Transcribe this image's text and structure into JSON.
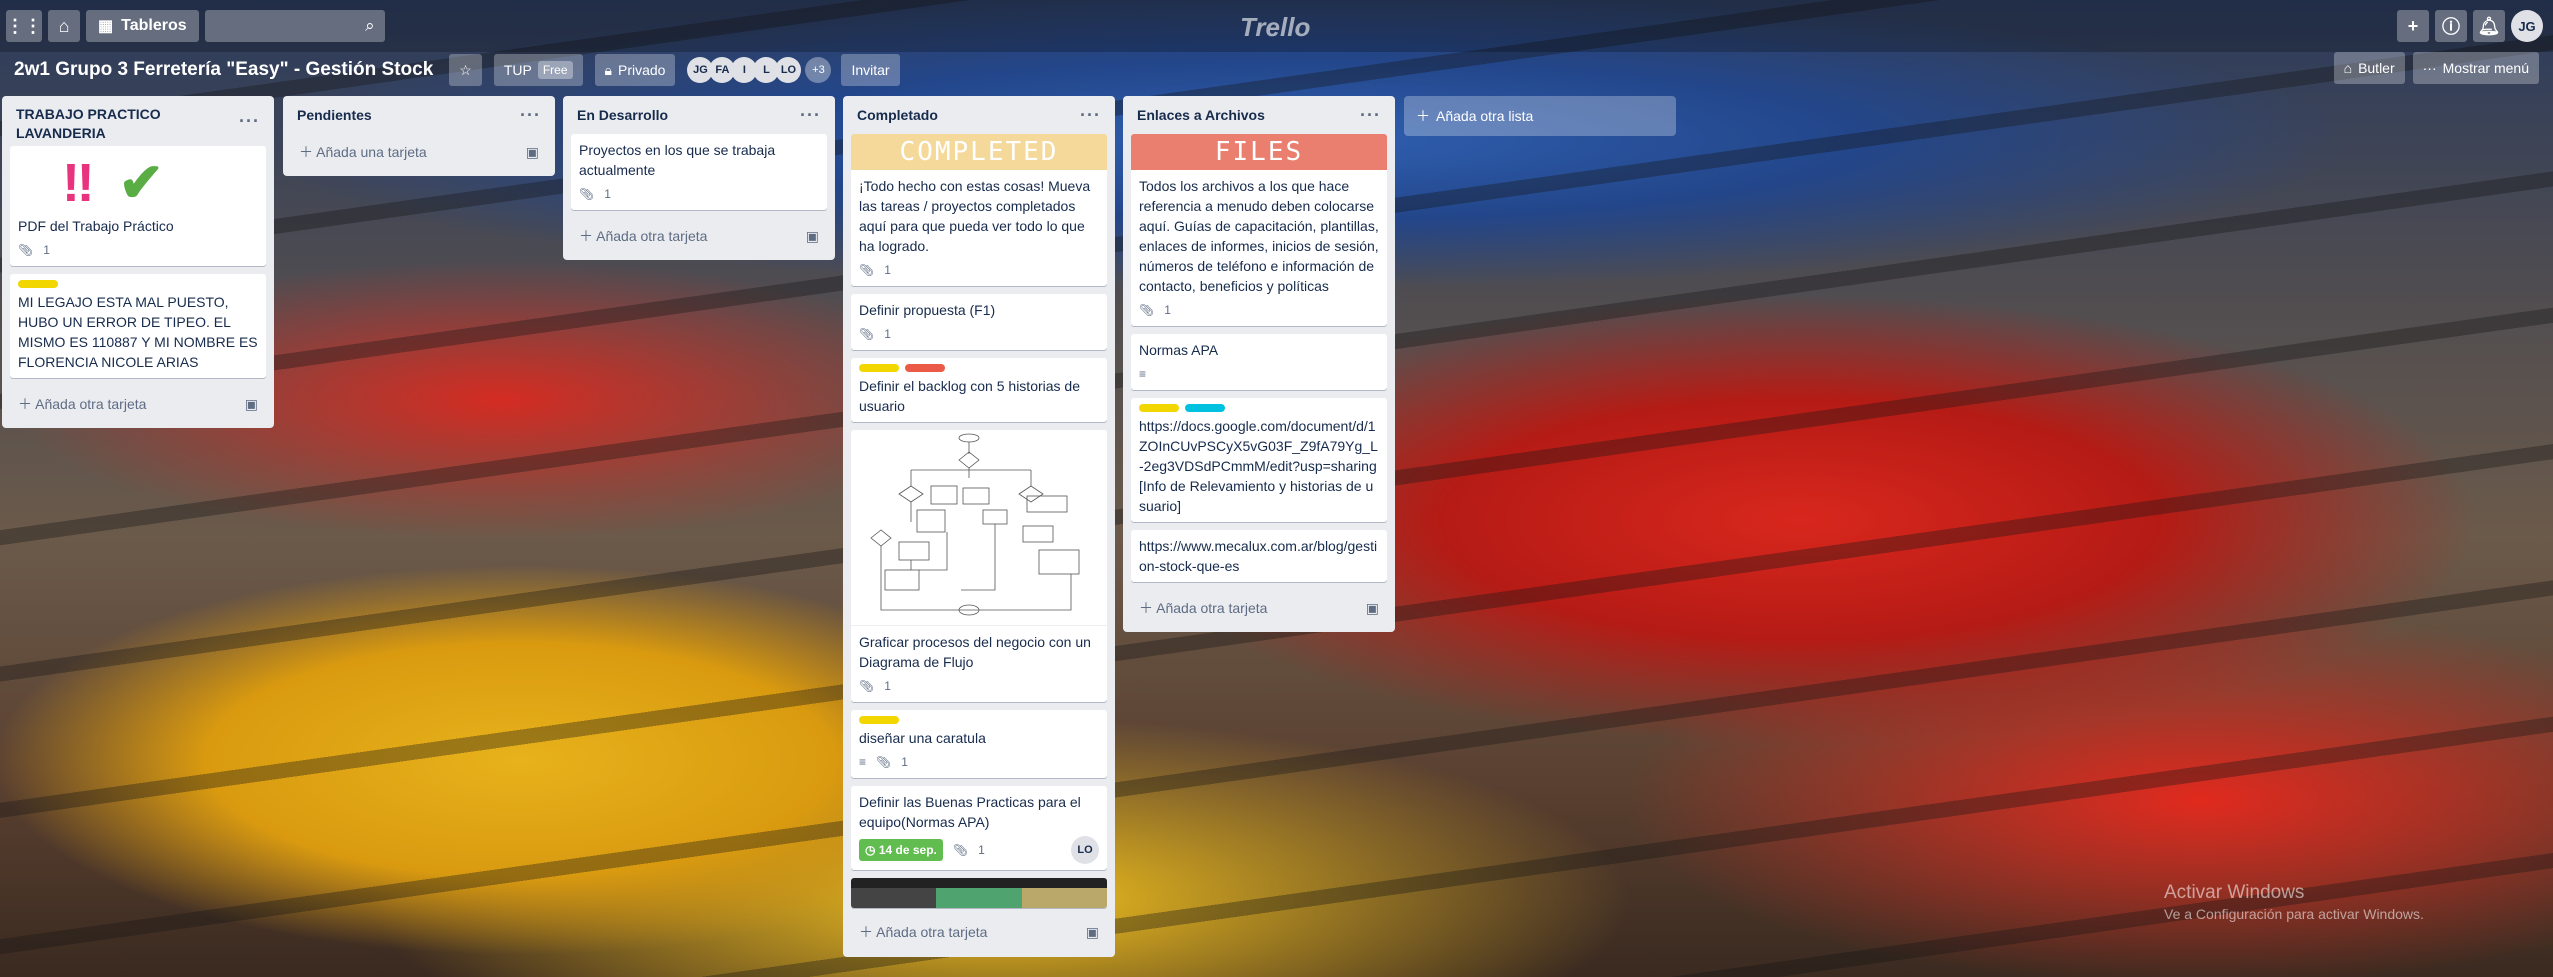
{
  "header": {
    "boards_label": "Tableros",
    "search_placeholder": "",
    "logo": "Trello",
    "user_initials": "JG"
  },
  "board": {
    "title": "2w1 Grupo 3 Ferretería \"Easy\" - Gestión Stock",
    "team": "TUP",
    "team_badge": "Free",
    "visibility": "Privado",
    "members": [
      "JG",
      "FA",
      "I",
      "L",
      "LO"
    ],
    "more_members": "+3",
    "invite": "Invitar",
    "butler": "Butler",
    "show_menu": "Mostrar menú"
  },
  "lists": [
    {
      "title": "TRABAJO PRACTICO LAVANDERIA",
      "cards": [
        {
          "text": "PDF del Trabajo Práctico",
          "attachments": "1"
        },
        {
          "text": "MI LEGAJO ESTA MAL PUESTO, HUBO UN ERROR DE TIPEO. EL MISMO ES 110887 Y MI NOMBRE ES FLORENCIA NICOLE ARIAS"
        }
      ],
      "add": "Añada otra tarjeta"
    },
    {
      "title": "Pendientes",
      "cards": [],
      "add": "Añada una tarjeta"
    },
    {
      "title": "En Desarrollo",
      "cards": [
        {
          "text": "Proyectos en los que se trabaja actualmente",
          "attachments": "1"
        }
      ],
      "add": "Añada otra tarjeta"
    },
    {
      "title": "Completado",
      "cover": "COMPLETED",
      "cards": [
        {
          "text": "¡Todo hecho con estas cosas! Mueva las tareas / proyectos completados aquí para que pueda ver todo lo que ha logrado.",
          "attachments": "1"
        },
        {
          "text": "Definir propuesta (F1)",
          "attachments": "1"
        },
        {
          "text": "Definir el backlog con 5 historias de usuario"
        },
        {
          "text": "Graficar procesos del negocio con un Diagrama de Flujo",
          "attachments": "1"
        },
        {
          "text": "diseñar una caratula",
          "attachments": "1"
        },
        {
          "text": "Definir las Buenas Practicas para el equipo(Normas APA)",
          "due": "14 de sep.",
          "attachments": "1",
          "member": "LO"
        }
      ],
      "add": "Añada otra tarjeta"
    },
    {
      "title": "Enlaces a Archivos",
      "cover": "FILES",
      "cards": [
        {
          "text": "Todos los archivos a los que hace referencia a menudo deben colocarse aquí. Guías de capacitación, plantillas, enlaces de informes, inicios de sesión, números de teléfono e información de contacto, beneficios y políticas",
          "attachments": "1"
        },
        {
          "text": "Normas APA"
        },
        {
          "text": "https://docs.google.com/document/d/1ZOInCUvPSCyX5vG03F_Z9fA79Yg_L-2eg3VDSdPCmmM/edit?usp=sharing [Info de Relevamiento y historias de usuario]"
        },
        {
          "text": "https://www.mecalux.com.ar/blog/gestion-stock-que-es"
        }
      ],
      "add": "Añada otra tarjeta"
    }
  ],
  "add_list": "Añada otra lista",
  "watermark": {
    "title": "Activar Windows",
    "sub": "Ve a Configuración para activar Windows."
  },
  "colors": {
    "yellow": "#f2d600",
    "red": "#eb5a46",
    "sky": "#00c2e0",
    "green": "#61bd4f",
    "completed_cover": "#f5d99a",
    "files_cover": "#eb7f6f"
  }
}
